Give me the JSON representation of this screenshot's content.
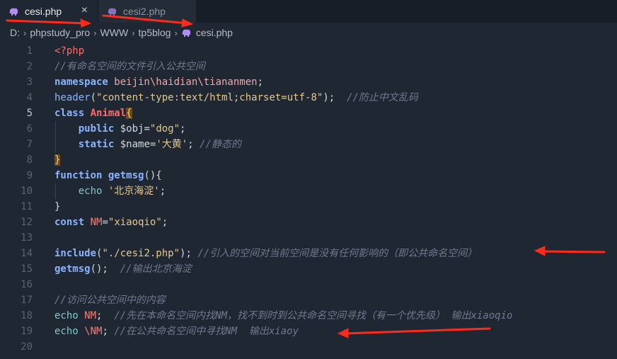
{
  "tabs": [
    {
      "label": "cesi.php",
      "active": true,
      "close": "×"
    },
    {
      "label": "cesi2.php",
      "active": false
    }
  ],
  "breadcrumb": [
    "D:",
    "phpstudy_pro",
    "WWW",
    "tp5blog",
    "cesi.php"
  ],
  "current_line": 5,
  "line_numbers": [
    "1",
    "2",
    "3",
    "4",
    "5",
    "6",
    "7",
    "8",
    "9",
    "10",
    "11",
    "12",
    "13",
    "14",
    "15",
    "16",
    "17",
    "18",
    "19",
    "20"
  ],
  "code": {
    "l1": {
      "t1": "<?php"
    },
    "l2": {
      "t1": "//有命名空间的文件引入公共空间"
    },
    "l3": {
      "t1": "namespace",
      "t2": " beijin\\haidian\\tiananmen",
      "t3": ";"
    },
    "l4": {
      "t1": "header",
      "t2": "(",
      "t3": "\"content-type:text/html;charset=utf-8\"",
      "t4": ");  ",
      "t5": "//防止中文乱码"
    },
    "l5": {
      "t1": "class",
      "t2": " Animal",
      "t3": "{"
    },
    "l6": {
      "t1": "    public",
      "t2": " $obj",
      "t3": "=",
      "t4": "\"dog\"",
      "t5": ";"
    },
    "l7": {
      "t1": "    static",
      "t2": " $name",
      "t3": "=",
      "t4": "'大黄'",
      "t5": "; ",
      "t6": "//静态的"
    },
    "l8": {
      "t1": "}"
    },
    "l9": {
      "t1": "function",
      "t2": " getmsg",
      "t3": "(){"
    },
    "l10": {
      "t1": "    echo",
      "t2": " '北京海淀'",
      "t3": ";"
    },
    "l11": {
      "t1": "}"
    },
    "l12": {
      "t1": "const",
      "t2": " NM",
      "t3": "=",
      "t4": "\"xiaoqio\"",
      "t5": ";"
    },
    "l14": {
      "t1": "include",
      "t2": "(",
      "t3": "\"./cesi2.php\"",
      "t4": "); ",
      "t5": "//引入的空间对当前空间是没有任何影响的（即公共命名空间）"
    },
    "l15": {
      "t1": "getmsg",
      "t2": "();  ",
      "t3": "//输出北京海淀"
    },
    "l17": {
      "t1": "//访问公共空间中的内容"
    },
    "l18": {
      "t1": "echo",
      "t2": " NM",
      "t3": ";  ",
      "t4": "//先在本命名空间内找NM，找不到时到公共命名空间寻找（有一个优先级） 输出xiaoqio"
    },
    "l19": {
      "t1": "echo",
      "t2": " \\NM",
      "t3": "; ",
      "t4": "//在公共命名空间中寻找NM  输出xiaoy"
    }
  },
  "colors": {
    "background": "#1f2733",
    "keyword": "#8ab4ff",
    "string": "#e3c88e",
    "comment": "#6f7a8e",
    "annotation_arrow": "#ff2a1a"
  },
  "icons": [
    "php-elephant-icon",
    "close-icon",
    "chevron-right-icon"
  ]
}
